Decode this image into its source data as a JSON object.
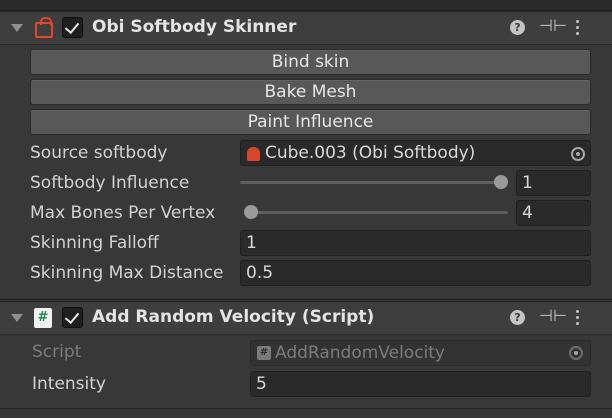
{
  "skinner": {
    "title": "Obi Softbody Skinner",
    "icon": "softbody-icon",
    "enabled": true,
    "buttons": {
      "bind_skin": "Bind skin",
      "bake_mesh": "Bake Mesh",
      "paint_influence": "Paint Influence"
    },
    "source_softbody": {
      "label": "Source softbody",
      "value": "Cube.003 (Obi Softbody)"
    },
    "softbody_influence": {
      "label": "Softbody Influence",
      "value": "1",
      "slider_min": 0,
      "slider_max": 1,
      "slider_value": 1
    },
    "max_bones_per_vertex": {
      "label": "Max Bones Per Vertex",
      "value": "4",
      "slider_fraction": 0
    },
    "skinning_falloff": {
      "label": "Skinning Falloff",
      "value": "1"
    },
    "skinning_max_distance": {
      "label": "Skinning Max Distance",
      "value": "0.5"
    }
  },
  "random_velocity": {
    "title": "Add Random Velocity (Script)",
    "icon": "csharp-script-icon",
    "enabled": true,
    "script": {
      "label": "Script",
      "value": "AddRandomVelocity"
    },
    "intensity": {
      "label": "Intensity",
      "value": "5"
    }
  },
  "header_icons": [
    "help-icon",
    "presets-icon",
    "kebab-menu-icon"
  ],
  "colors": {
    "background": "#383838",
    "header": "#3e3e3e",
    "field": "#2a2a2a",
    "button": "#585858",
    "softbody_red": "#e4462c",
    "script_green": "#1e8a4c"
  }
}
